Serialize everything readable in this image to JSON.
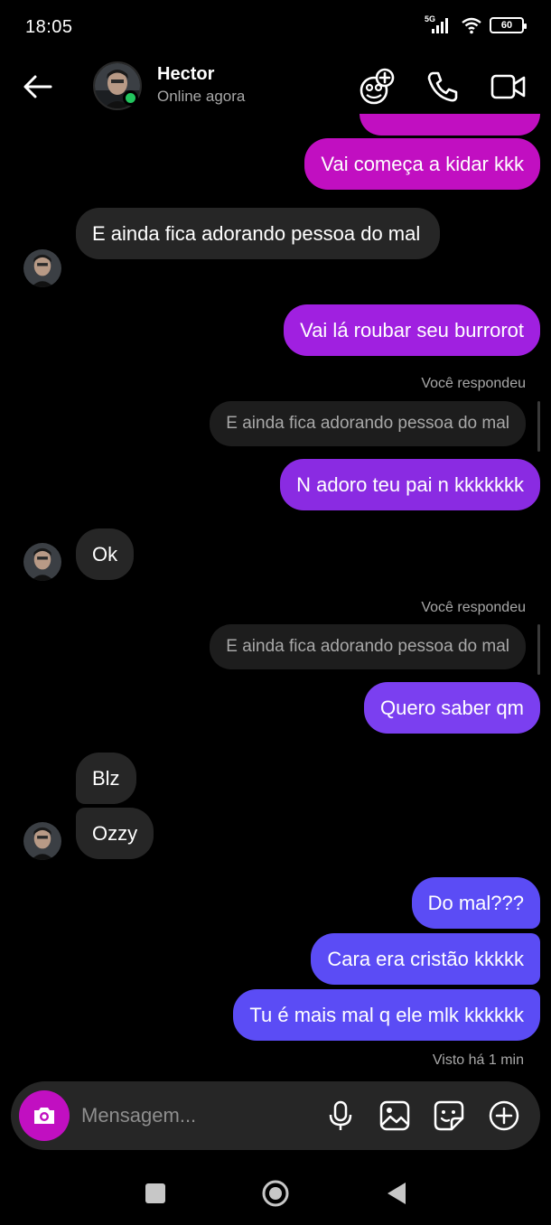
{
  "status_bar": {
    "time": "18:05",
    "network": "5G",
    "battery": "60"
  },
  "header": {
    "name": "Hector",
    "status": "Online agora"
  },
  "messages": {
    "m0": "Vai começa a kidar kkk",
    "m1": "E ainda fica adorando pessoa do mal",
    "m2": "Vai lá roubar seu burrorot",
    "reply1_label": "Você respondeu",
    "reply1_quote": "E ainda fica adorando pessoa do mal",
    "m3": "N adoro teu pai n kkkkkkk",
    "m4": "Ok",
    "reply2_label": "Você respondeu",
    "reply2_quote": "E ainda fica adorando pessoa do mal",
    "m5": "Quero saber qm",
    "m6": "Blz",
    "m7": "Ozzy",
    "m8": "Do mal???",
    "m9": "Cara era cristão kkkkk",
    "m10": "Tu é mais mal q ele mlk kkkkkk",
    "seen": "Visto há 1 min"
  },
  "composer": {
    "placeholder": "Mensagem..."
  },
  "colors": {
    "sent_pink": "#c10fc1",
    "sent_purple_light": "#a020e0",
    "sent_purple": "#8a2be2",
    "sent_violet": "#7b3ff0",
    "sent_indigo": "#5b4cf5",
    "received": "#262626",
    "online": "#22c55e"
  },
  "icons": {
    "back": "arrow-left-icon",
    "add_person": "add-person-icon",
    "call": "phone-icon",
    "video": "video-camera-icon",
    "camera": "camera-icon",
    "mic": "microphone-icon",
    "gallery": "image-icon",
    "sticker": "sticker-icon",
    "more": "plus-circle-icon"
  }
}
